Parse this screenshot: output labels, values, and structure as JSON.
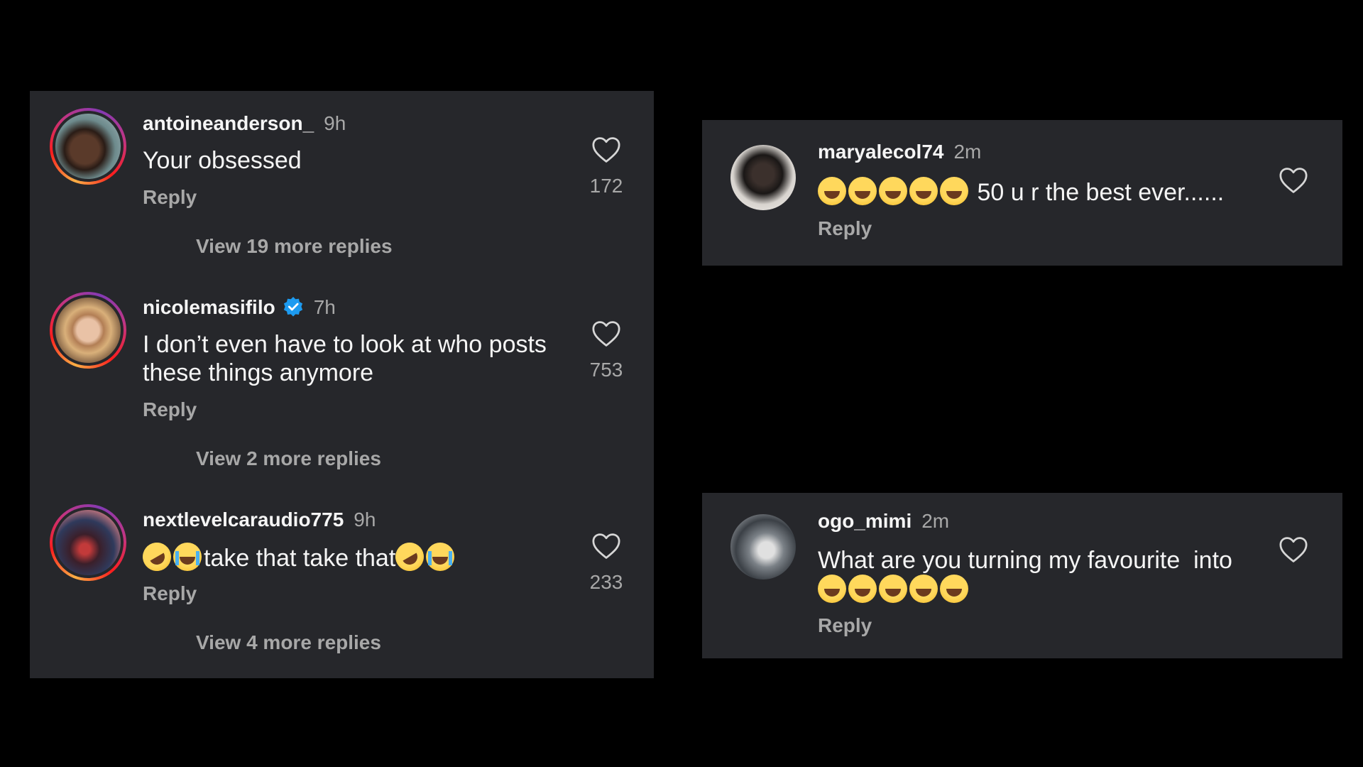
{
  "left_panel": {
    "comments": [
      {
        "username": "antoineanderson_",
        "time": "9h",
        "text": "Your obsessed",
        "reply_label": "Reply",
        "likes": "172",
        "view_more": "View 19 more replies",
        "verified": false
      },
      {
        "username": "nicolemasifilo",
        "time": "7h",
        "text_line1": "I don’t even have to look at who posts",
        "text_line2": "these things anymore",
        "reply_label": "Reply",
        "likes": "753",
        "view_more": "View 2 more replies",
        "verified": true
      },
      {
        "username": "nextlevelcaraudio775",
        "time": "9h",
        "text_a": "take that take that",
        "reply_label": "Reply",
        "likes": "233",
        "view_more": "View 4 more replies",
        "verified": false
      }
    ]
  },
  "right_top": {
    "username": "maryalecol74",
    "time": "2m",
    "text": "50 u r the best ever......",
    "reply_label": "Reply"
  },
  "right_bottom": {
    "username": "ogo_mimi",
    "time": "2m",
    "text": "What are you turning my favourite  into",
    "reply_label": "Reply"
  },
  "icons": {
    "like": "heart-outline-icon",
    "verified": "verified-badge-icon",
    "laugh": "face-with-tears-of-joy-emoji",
    "rofl": "rolling-on-floor-laughing-emoji",
    "cry": "loudly-crying-face-emoji"
  },
  "colors": {
    "background": "#000000",
    "panel": "#26272b",
    "primary_text": "#f5f5f5",
    "secondary_text": "#a8a8a8",
    "verified_blue": "#1d9bf0"
  }
}
